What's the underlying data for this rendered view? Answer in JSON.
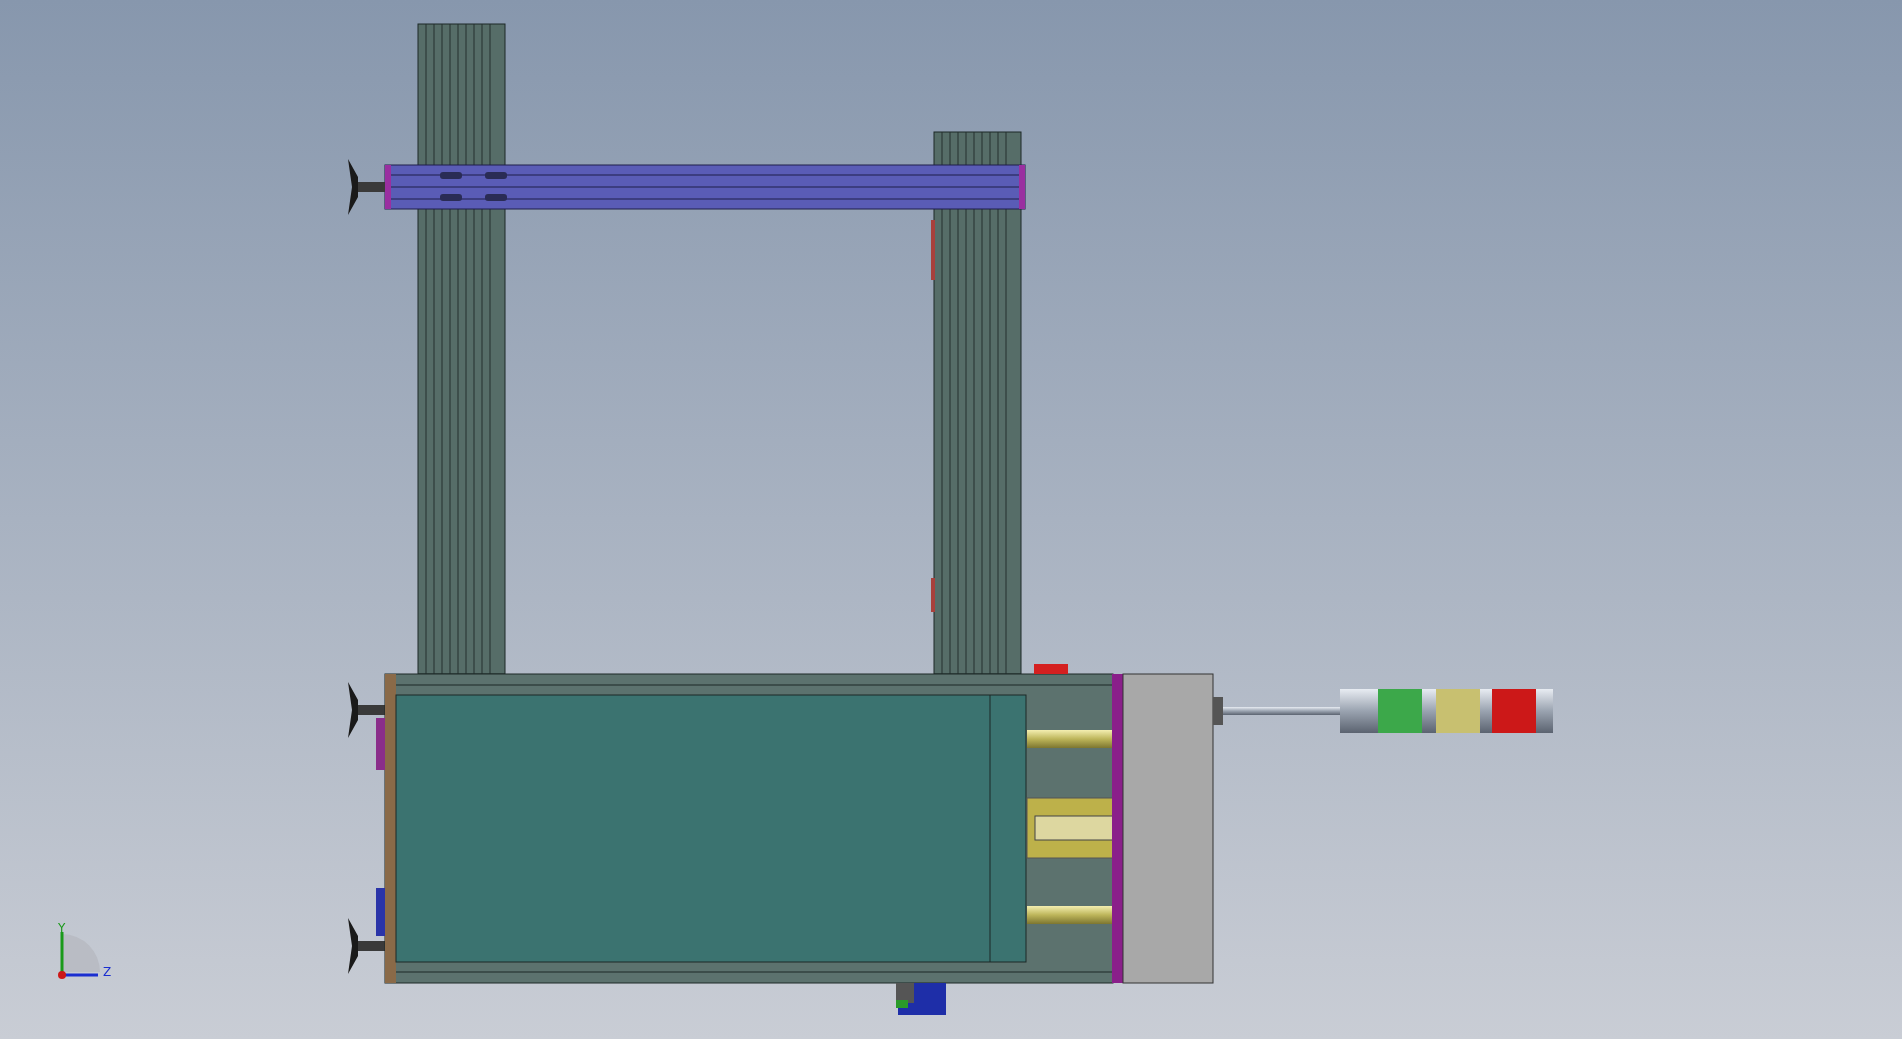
{
  "viewport": {
    "triad": {
      "axis_labels": [
        "Y",
        "Z"
      ]
    }
  }
}
